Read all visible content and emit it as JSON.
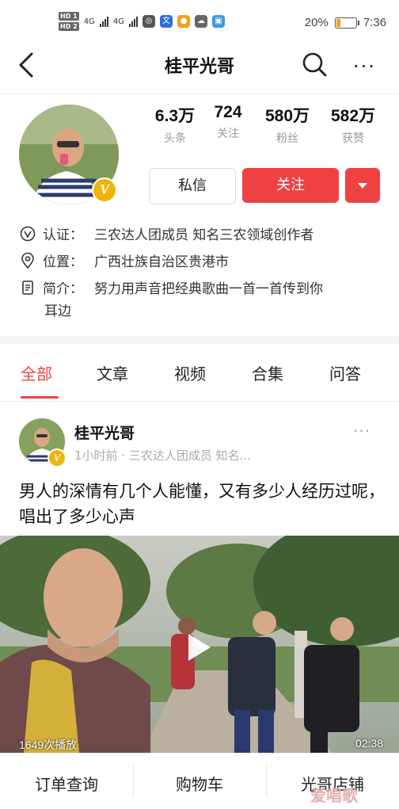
{
  "status_bar": {
    "hd1": "HD 1",
    "hd2": "HD 2",
    "net1": "4G",
    "net2": "4G",
    "battery_percent": "20%",
    "battery_level": 0.2,
    "time": "7:36",
    "app_icons": [
      "wechat-icon",
      "translate-icon",
      "orange-app-icon",
      "cloud-icon",
      "blue-app-icon"
    ]
  },
  "header": {
    "title": "桂平光哥"
  },
  "profile": {
    "stats": [
      {
        "num": "6.3万",
        "label": "头条"
      },
      {
        "num": "724",
        "label": "关注"
      },
      {
        "num": "580万",
        "label": "粉丝"
      },
      {
        "num": "582万",
        "label": "获赞"
      }
    ],
    "verified_badge": "V",
    "message_label": "私信",
    "follow_label": "关注",
    "info": [
      {
        "icon": "verified-icon",
        "key": "认证：",
        "value": "三农达人团成员 知名三农领域创作者"
      },
      {
        "icon": "location-icon",
        "key": "位置：",
        "value": "广西壮族自治区贵港市"
      },
      {
        "icon": "document-icon",
        "key": "简介：",
        "value": "努力用声音把经典歌曲一首一首传到你"
      }
    ],
    "bio_continued": "耳边"
  },
  "tabs": [
    {
      "label": "全部",
      "active": true
    },
    {
      "label": "文章",
      "active": false
    },
    {
      "label": "视频",
      "active": false
    },
    {
      "label": "合集",
      "active": false
    },
    {
      "label": "问答",
      "active": false
    }
  ],
  "post": {
    "author": "桂平光哥",
    "verified_badge": "V",
    "meta": "1小时前 · 三农达人团成员 知名...",
    "more": "···",
    "text": "男人的深情有几个人能懂，又有多少人经历过呢，唱出了多少心声",
    "video": {
      "plays": "1649次播放",
      "duration": "02:38"
    }
  },
  "bottom_bar": {
    "items": [
      "订单查询",
      "购物车",
      "光哥店铺"
    ]
  },
  "watermark": "爱唱歌",
  "colors": {
    "accent": "#f04142",
    "badge": "#f0b30a",
    "muted": "#999999"
  }
}
